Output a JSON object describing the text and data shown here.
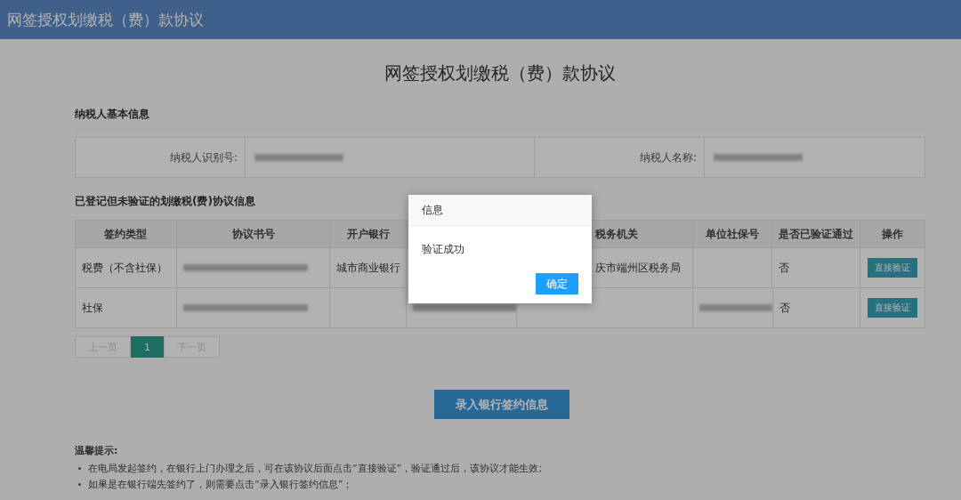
{
  "header": {
    "title": "网签授权划缴税（费）款协议"
  },
  "page_title": "网签授权划缴税（费）款协议",
  "basic_info": {
    "heading": "纳税人基本信息",
    "fields": [
      {
        "label": "纳税人识别号:",
        "redacted": true
      },
      {
        "label": "纳税人名称:",
        "redacted": true
      }
    ]
  },
  "agreements": {
    "heading": "已登记但未验证的划缴税(费)协议信息",
    "columns": [
      "签约类型",
      "协议书号",
      "开户银行",
      null,
      "税务机关",
      "单位社保号",
      "是否已验证通过",
      "操作"
    ],
    "rows": [
      {
        "cells": [
          {
            "kind": "text",
            "text": "税费（不含社保）"
          },
          {
            "kind": "redacted"
          },
          {
            "kind": "text",
            "text": "城市商业银行"
          },
          {
            "kind": "empty"
          },
          {
            "kind": "text",
            "text": "庆市端州区税务局"
          },
          {
            "kind": "empty"
          },
          {
            "kind": "text",
            "text": "否"
          }
        ],
        "action": "直接验证"
      },
      {
        "cells": [
          {
            "kind": "text",
            "text": "社保"
          },
          {
            "kind": "redacted"
          },
          {
            "kind": "empty"
          },
          {
            "kind": "redacted"
          },
          {
            "kind": "empty"
          },
          {
            "kind": "redacted"
          },
          {
            "kind": "text",
            "text": "否"
          }
        ],
        "action": "直接验证"
      }
    ]
  },
  "pagination": [
    {
      "label": "上一页",
      "selected": false
    },
    {
      "label": "1",
      "selected": true
    },
    {
      "label": "下一页",
      "selected": false
    }
  ],
  "primary_button": "录入银行签约信息",
  "tips": {
    "heading": "温馨提示:",
    "items": [
      "在电局发起签约，在银行上门办理之后，可在该协议后面点击“直接验证”，验证通过后，该协议才能生效;",
      "如果是在银行端先签约了，则需要点击“录入银行签约信息”；"
    ]
  },
  "dialog": {
    "title": "信息",
    "message": "验证成功",
    "button": "确定"
  }
}
